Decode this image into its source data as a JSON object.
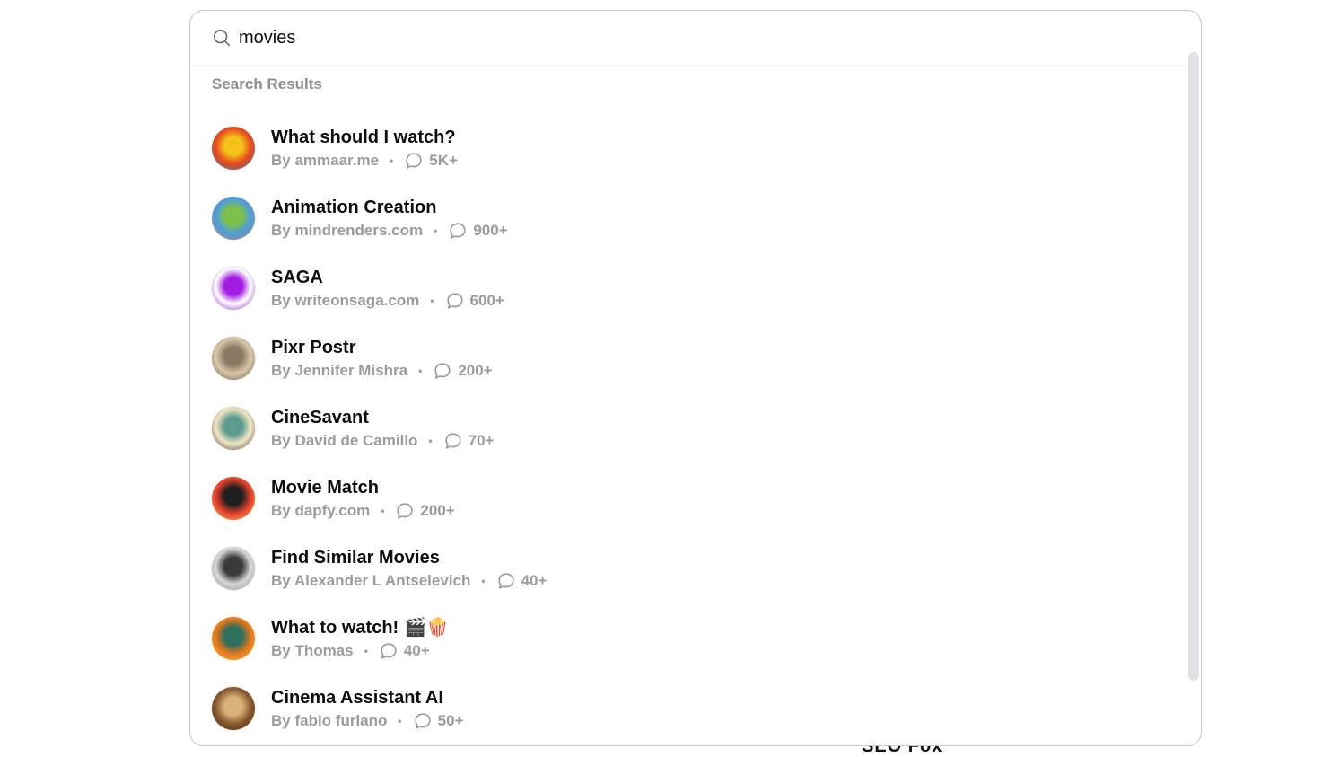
{
  "background": {
    "partial_text": "SEO Fox"
  },
  "search": {
    "query": "movies",
    "icon": "search-icon"
  },
  "results": {
    "title": "Search Results",
    "items": [
      {
        "name": "What should I watch?",
        "author": "By ammaar.me",
        "conversations": "5K+",
        "avatar_colors": [
          "#e84a1c",
          "#f5c21b",
          "#2a7ab0"
        ]
      },
      {
        "name": "Animation Creation",
        "author": "By mindrenders.com",
        "conversations": "900+",
        "avatar_colors": [
          "#4e9be0",
          "#7cc24a",
          "#c98a3e"
        ]
      },
      {
        "name": "SAGA",
        "author": "By writeonsaga.com",
        "conversations": "600+",
        "avatar_colors": [
          "#ffffff",
          "#a11de0",
          "#7b12c9"
        ]
      },
      {
        "name": "Pixr Postr",
        "author": "By Jennifer Mishra",
        "conversations": "200+",
        "avatar_colors": [
          "#d9c7a8",
          "#8a7a64",
          "#5a4e3e"
        ]
      },
      {
        "name": "CineSavant",
        "author": "By David de Camillo",
        "conversations": "70+",
        "avatar_colors": [
          "#f3e6c4",
          "#5e9a8e",
          "#2b2b2b"
        ]
      },
      {
        "name": "Movie Match",
        "author": "By dapfy.com",
        "conversations": "200+",
        "avatar_colors": [
          "#e3402c",
          "#1f1f1f",
          "#f3c85a"
        ]
      },
      {
        "name": "Find Similar Movies",
        "author": "By Alexander L Antselevich",
        "conversations": "40+",
        "avatar_colors": [
          "#d6d6d6",
          "#3a3a3a",
          "#8c8c8c"
        ]
      },
      {
        "name": "What to watch!",
        "name_emoji": "🎬🍿",
        "author": "By Thomas",
        "conversations": "40+",
        "avatar_colors": [
          "#e5761c",
          "#2e6f5e",
          "#f5c840"
        ]
      },
      {
        "name": "Cinema Assistant AI",
        "author": "By fabio furlano",
        "conversations": "50+",
        "avatar_colors": [
          "#8a5a2e",
          "#d9b27a",
          "#3a2617"
        ]
      }
    ]
  }
}
